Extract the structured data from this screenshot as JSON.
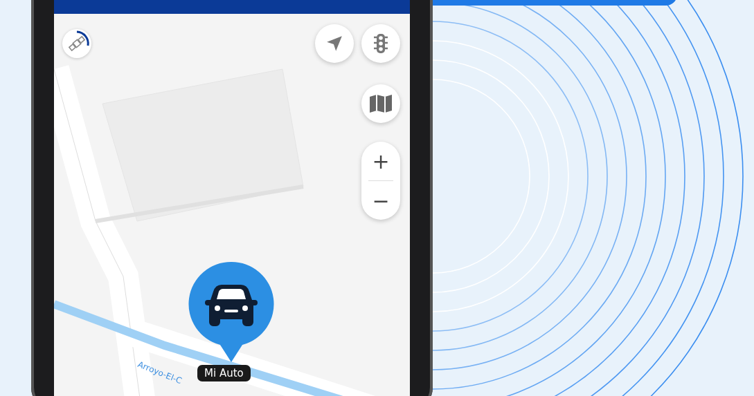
{
  "map": {
    "street_label": "Arroyo-El-C",
    "marker": {
      "label": "Mi Auto"
    }
  },
  "controls": [
    {
      "kind": "locate"
    },
    {
      "kind": "traffic"
    },
    {
      "kind": "layers"
    }
  ],
  "zoom": {
    "in_label": "+",
    "out_label": "−"
  }
}
